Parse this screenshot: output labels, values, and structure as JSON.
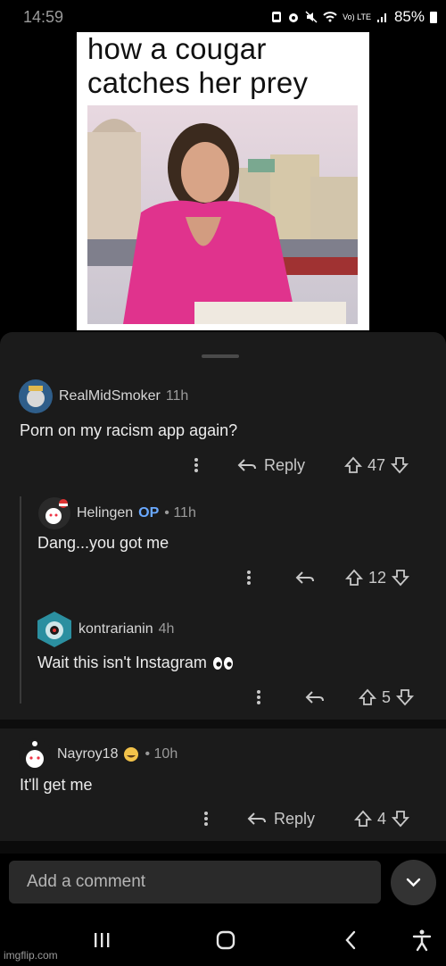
{
  "status_bar": {
    "time": "14:59",
    "network": "Vo) LTE",
    "battery": "85%"
  },
  "post": {
    "caption": "how a cougar catches her prey"
  },
  "comments": [
    {
      "author": "RealMidSmoker",
      "time": "11h",
      "text": "Porn on my racism app again?",
      "reply_label": "Reply",
      "votes": "47"
    },
    {
      "author": "Helingen",
      "op": "OP",
      "time": "• 11h",
      "text": "Dang...you got me",
      "votes": "12"
    },
    {
      "author": "kontrarianin",
      "time": "4h",
      "text": "Wait this isn't Instagram",
      "votes": "5"
    },
    {
      "author": "Nayroy18",
      "time": "• 10h",
      "text": "It'll get me",
      "reply_label": "Reply",
      "votes": "4"
    }
  ],
  "composer": {
    "placeholder": "Add a comment"
  },
  "watermark": "imgflip.com",
  "colors": {
    "background": "#000000",
    "sheet": "#1b1b1b",
    "op_badge": "#6aa9ff"
  }
}
